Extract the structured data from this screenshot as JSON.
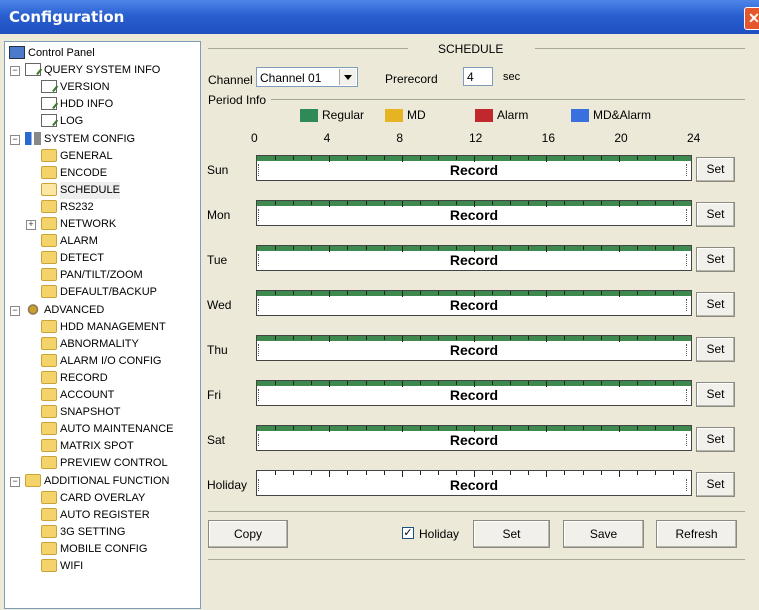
{
  "window": {
    "title": "Configuration",
    "close_glyph": "✕"
  },
  "tree": [
    {
      "label": "Control Panel",
      "icon": "monitor-icon",
      "level": 0
    },
    {
      "label": "QUERY SYSTEM INFO",
      "icon": "document-icon",
      "level": 1,
      "toggle": "−"
    },
    {
      "label": "VERSION",
      "icon": "document-icon",
      "level": 2
    },
    {
      "label": "HDD INFO",
      "icon": "document-icon",
      "level": 2
    },
    {
      "label": "LOG",
      "icon": "document-icon",
      "level": 2
    },
    {
      "label": "SYSTEM CONFIG",
      "icon": "tools-icon",
      "level": 1,
      "toggle": "−"
    },
    {
      "label": "GENERAL",
      "icon": "folder-icon",
      "level": 2
    },
    {
      "label": "ENCODE",
      "icon": "folder-icon",
      "level": 2
    },
    {
      "label": "SCHEDULE",
      "icon": "folder-open-icon",
      "level": 2
    },
    {
      "label": "RS232",
      "icon": "folder-icon",
      "level": 2
    },
    {
      "label": "NETWORK",
      "icon": "folder-icon",
      "level": 2,
      "toggle": "+"
    },
    {
      "label": "ALARM",
      "icon": "folder-icon",
      "level": 2
    },
    {
      "label": "DETECT",
      "icon": "folder-icon",
      "level": 2
    },
    {
      "label": "PAN/TILT/ZOOM",
      "icon": "folder-icon",
      "level": 2
    },
    {
      "label": "DEFAULT/BACKUP",
      "icon": "folder-icon",
      "level": 2
    },
    {
      "label": "ADVANCED",
      "icon": "gears-icon",
      "level": 1,
      "toggle": "−"
    },
    {
      "label": "HDD MANAGEMENT",
      "icon": "folder-icon",
      "level": 2
    },
    {
      "label": "ABNORMALITY",
      "icon": "folder-icon",
      "level": 2
    },
    {
      "label": "ALARM I/O CONFIG",
      "icon": "folder-icon",
      "level": 2
    },
    {
      "label": "RECORD",
      "icon": "folder-icon",
      "level": 2
    },
    {
      "label": "ACCOUNT",
      "icon": "folder-icon",
      "level": 2
    },
    {
      "label": "SNAPSHOT",
      "icon": "folder-icon",
      "level": 2
    },
    {
      "label": "AUTO MAINTENANCE",
      "icon": "folder-icon",
      "level": 2
    },
    {
      "label": "MATRIX SPOT",
      "icon": "folder-icon",
      "level": 2
    },
    {
      "label": "PREVIEW CONTROL",
      "icon": "folder-icon",
      "level": 2
    },
    {
      "label": "ADDITIONAL FUNCTION",
      "icon": "folder-icon",
      "level": 1,
      "toggle": "−"
    },
    {
      "label": "CARD OVERLAY",
      "icon": "folder-icon",
      "level": 2
    },
    {
      "label": "AUTO REGISTER",
      "icon": "folder-icon",
      "level": 2
    },
    {
      "label": "3G SETTING",
      "icon": "folder-icon",
      "level": 2
    },
    {
      "label": "MOBILE CONFIG",
      "icon": "folder-icon",
      "level": 2
    },
    {
      "label": "WIFI",
      "icon": "folder-icon",
      "level": 2
    }
  ],
  "schedule": {
    "section_title": "SCHEDULE",
    "channel_label": "Channel",
    "channel_value": "Channel 01",
    "prerecord_label": "Prerecord",
    "prerecord_value": "4",
    "prerecord_unit": "sec",
    "period_info_label": "Period Info",
    "legend": [
      {
        "label": "Regular",
        "color": "#2e8b57"
      },
      {
        "label": "MD",
        "color": "#e6b422"
      },
      {
        "label": "Alarm",
        "color": "#c0282d"
      },
      {
        "label": "MD&Alarm",
        "color": "#3a6fe0"
      }
    ],
    "hours": [
      "0",
      "4",
      "8",
      "12",
      "16",
      "20",
      "24"
    ],
    "days": [
      {
        "name": "Sun",
        "status": "Record",
        "regular_fraction": 1.0
      },
      {
        "name": "Mon",
        "status": "Record",
        "regular_fraction": 1.0
      },
      {
        "name": "Tue",
        "status": "Record",
        "regular_fraction": 1.0
      },
      {
        "name": "Wed",
        "status": "Record",
        "regular_fraction": 1.0
      },
      {
        "name": "Thu",
        "status": "Record",
        "regular_fraction": 1.0
      },
      {
        "name": "Fri",
        "status": "Record",
        "regular_fraction": 1.0
      },
      {
        "name": "Sat",
        "status": "Record",
        "regular_fraction": 1.0
      },
      {
        "name": "Holiday",
        "status": "Record",
        "regular_fraction": 0
      }
    ],
    "set_label": "Set",
    "copy_label": "Copy",
    "holiday_label": "Holiday",
    "holiday_checked": true,
    "bottom_set_label": "Set",
    "save_label": "Save",
    "refresh_label": "Refresh"
  }
}
